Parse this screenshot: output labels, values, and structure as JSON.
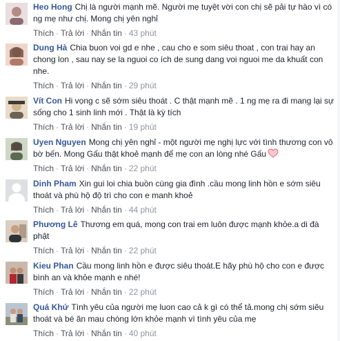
{
  "actions": {
    "like": "Thích",
    "reply": "Trả lời",
    "message": "Nhắn tin",
    "separator": "·"
  },
  "comments": [
    {
      "author": "Heo Hong",
      "text": "Chị là người mạnh mẽ. Người mẹ tuyệt vời con chị sẽ pải tự hào vì có ng mẹ như chị. Mong chị yên nghỉ",
      "time": "43 phút",
      "avatar_color": "#e9dfe0"
    },
    {
      "author": "Dung Hà",
      "text": "Chia buon voi gd e nhe , cau cho e som siêu thoat , con trai hay an chong lon , sau nay se la nguoi co ích de sung dang voi nguoi me da khuất con nhe.",
      "time": "29 phút",
      "avatar_color": "#efd6cc"
    },
    {
      "author": "Vít Con",
      "text": "Hi vọng c sẽ sớm siêu thoát . C thật mạnh mẽ . 1 ng mẹ ra đi mang lại sự sống cho 1 sinh linh mới . Thật là kỳ tích",
      "time": "19 phút",
      "avatar_color": "#e7dcc9"
    },
    {
      "author": "Uyen Nguyen",
      "text": "Mong chị yên nghỉ - một người mẹ nghị lực với tình thương con vô bờ bến. Mong Gấu thật khoẻ mạnh để mẹ con an lòng nhé Gấu",
      "time": "22 phút",
      "avatar_color": "#cfd8c4"
    },
    {
      "author": "Dinh Pham",
      "text": "Xin gui loi chia buồn cùng gia đình .cầu mong linh hồn e sớm siêu thoát và phù hộ độ trì cho con e manh khoẻ",
      "time": "44 phút",
      "avatar_color": "#dddfe2"
    },
    {
      "author": "Phương Lê",
      "text": "Thương em quá, mong con trai em luôn được mạnh khỏe.a di đà phật",
      "time": "22 phút",
      "avatar_color": "#d9cfc2"
    },
    {
      "author": "Kieu Phan",
      "text": "Cầu mong linh hồn e được siêu thoát.E hãy phù hộ cho con e được bình an và khỏe mạnh e nhé!",
      "time": "22 phút",
      "avatar_color": "#c9b9ad"
    },
    {
      "author": "Quá Khứ",
      "text": "Tình yêu của người mẹ luon cao cả k gì có thể tả.mong chị sớm siêu thoát và bé ăn mau chóng lớn khỏe mạnh vì tình yêu của mẹ",
      "time": "40 phút",
      "avatar_color": "#b9c6d2"
    }
  ]
}
